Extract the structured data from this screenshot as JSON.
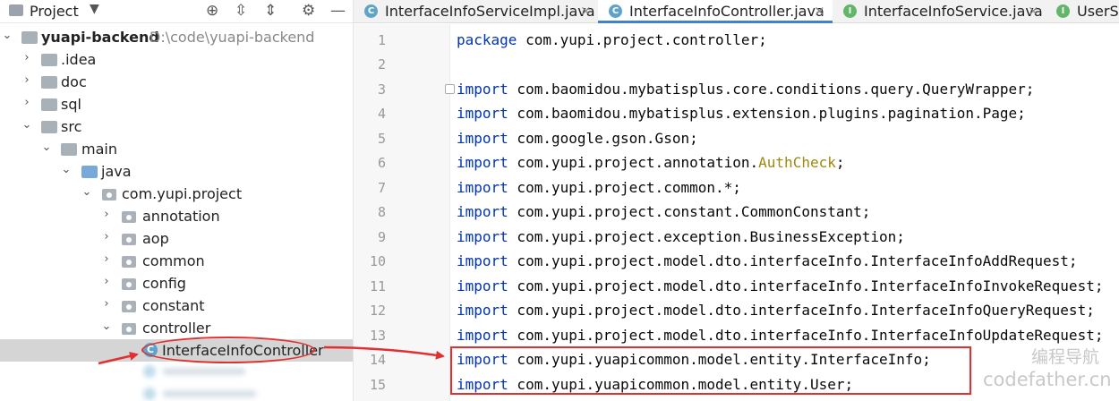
{
  "project_panel": {
    "title": "Project",
    "tree": [
      {
        "label": "yuapi-backend",
        "path": "D:\\code\\yuapi-backend",
        "depth": 0,
        "expanded": true,
        "kind": "project"
      },
      {
        "label": ".idea",
        "depth": 1,
        "expanded": false,
        "kind": "folder"
      },
      {
        "label": "doc",
        "depth": 1,
        "expanded": false,
        "kind": "folder"
      },
      {
        "label": "sql",
        "depth": 1,
        "expanded": false,
        "kind": "folder"
      },
      {
        "label": "src",
        "depth": 1,
        "expanded": true,
        "kind": "folder"
      },
      {
        "label": "main",
        "depth": 2,
        "expanded": true,
        "kind": "folder"
      },
      {
        "label": "java",
        "depth": 3,
        "expanded": true,
        "kind": "source-folder"
      },
      {
        "label": "com.yupi.project",
        "depth": 4,
        "expanded": true,
        "kind": "package"
      },
      {
        "label": "annotation",
        "depth": 5,
        "expanded": false,
        "kind": "package"
      },
      {
        "label": "aop",
        "depth": 5,
        "expanded": false,
        "kind": "package"
      },
      {
        "label": "common",
        "depth": 5,
        "expanded": false,
        "kind": "package"
      },
      {
        "label": "config",
        "depth": 5,
        "expanded": false,
        "kind": "package"
      },
      {
        "label": "constant",
        "depth": 5,
        "expanded": false,
        "kind": "package"
      },
      {
        "label": "controller",
        "depth": 5,
        "expanded": true,
        "kind": "package"
      },
      {
        "label": "InterfaceInfoController",
        "depth": 6,
        "kind": "class",
        "selected": true
      }
    ]
  },
  "tabs": [
    {
      "label": "InterfaceInfoServiceImpl.java",
      "icon": "class-icon",
      "active": false
    },
    {
      "label": "InterfaceInfoController.java",
      "icon": "class-icon",
      "active": true
    },
    {
      "label": "InterfaceInfoService.java",
      "icon": "interface-icon",
      "active": false
    },
    {
      "label": "UserSe",
      "icon": "interface-icon",
      "active": false
    }
  ],
  "editor": {
    "lines": [
      {
        "n": "1",
        "kw": "package",
        "rest": " com.yupi.project.controller;"
      },
      {
        "n": "2",
        "kw": "",
        "rest": ""
      },
      {
        "n": "3",
        "kw": "import",
        "rest": " com.baomidou.mybatisplus.core.conditions.query.QueryWrapper;"
      },
      {
        "n": "4",
        "kw": "import",
        "rest": " com.baomidou.mybatisplus.extension.plugins.pagination.Page;"
      },
      {
        "n": "5",
        "kw": "import",
        "rest": " com.google.gson.Gson;"
      },
      {
        "n": "6",
        "kw": "import",
        "rest": " com.yupi.project.annotation.",
        "ann": "AuthCheck",
        "tail": ";"
      },
      {
        "n": "7",
        "kw": "import",
        "rest": " com.yupi.project.common.*;"
      },
      {
        "n": "8",
        "kw": "import",
        "rest": " com.yupi.project.constant.CommonConstant;"
      },
      {
        "n": "9",
        "kw": "import",
        "rest": " com.yupi.project.exception.BusinessException;"
      },
      {
        "n": "10",
        "kw": "import",
        "rest": " com.yupi.project.model.dto.interfaceInfo.InterfaceInfoAddRequest;"
      },
      {
        "n": "11",
        "kw": "import",
        "rest": " com.yupi.project.model.dto.interfaceInfo.InterfaceInfoInvokeRequest;"
      },
      {
        "n": "12",
        "kw": "import",
        "rest": " com.yupi.project.model.dto.interfaceInfo.InterfaceInfoQueryRequest;"
      },
      {
        "n": "13",
        "kw": "import",
        "rest": " com.yupi.project.model.dto.interfaceInfo.InterfaceInfoUpdateRequest;"
      },
      {
        "n": "14",
        "kw": "import",
        "rest": " com.yupi.yuapicommon.model.entity.InterfaceInfo;"
      },
      {
        "n": "15",
        "kw": "import",
        "rest": " com.yupi.yuapicommon.model.entity.User;"
      }
    ]
  },
  "watermark": {
    "line1": "编程导航",
    "line2": "codefather.cn"
  },
  "colors": {
    "keyword": "#0033b3",
    "annotation": "#9e880d",
    "highlight": "#e03030",
    "active_tab": "#4083c9"
  }
}
